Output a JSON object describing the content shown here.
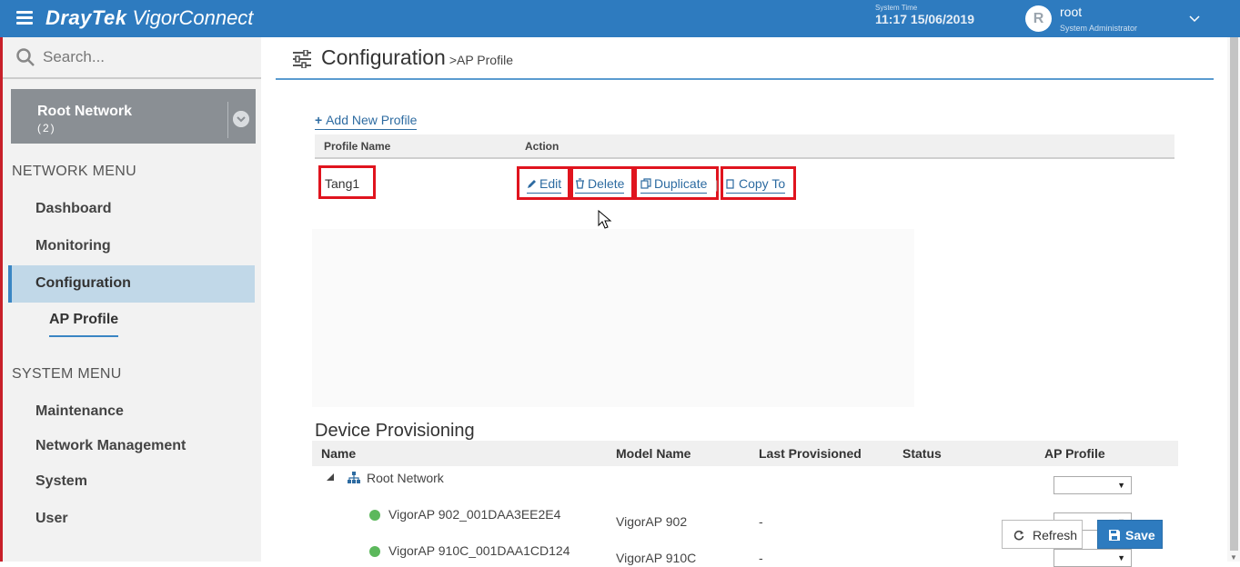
{
  "header": {
    "brand": "DrayTek",
    "product": "VigorConnect",
    "system_time_label": "System Time",
    "system_time": "11:17 15/06/2019",
    "avatar_letter": "R",
    "user_name": "root",
    "user_role": "System Administrator"
  },
  "sidebar": {
    "search_placeholder": "Search...",
    "network": {
      "name": "Root Network",
      "count": "(2)"
    },
    "network_menu_title": "NETWORK MENU",
    "network_menu": [
      "Dashboard",
      "Monitoring",
      "Configuration",
      "AP Profile"
    ],
    "system_menu_title": "SYSTEM MENU",
    "system_menu": [
      "Maintenance",
      "Network Management",
      "System",
      "User"
    ]
  },
  "page": {
    "title": "Configuration",
    "breadcrumb": ">AP Profile"
  },
  "profiles": {
    "add_label": "Add New Profile",
    "columns": [
      "Profile Name",
      "Action"
    ],
    "rows": [
      {
        "name": "Tang1"
      }
    ],
    "actions": {
      "edit": "Edit",
      "delete": "Delete",
      "duplicate": "Duplicate",
      "copy_to": "Copy To"
    }
  },
  "provisioning": {
    "title": "Device Provisioning",
    "columns": [
      "Name",
      "Model Name",
      "Last Provisioned",
      "Status",
      "AP Profile"
    ],
    "root_node": "Root Network",
    "devices": [
      {
        "name": "VigorAP 902_001DAA3EE2E4",
        "model": "VigorAP 902",
        "last": "-",
        "status": "ok"
      },
      {
        "name": "VigorAP 910C_001DAA1CD124",
        "model": "VigorAP 910C",
        "last": "-",
        "status": "ok"
      }
    ]
  },
  "buttons": {
    "refresh": "Refresh",
    "save": "Save"
  },
  "colors": {
    "header": "#2e7bbf",
    "highlight": "#e0141e",
    "active_menu": "#c1d8e8",
    "link": "#2d6ba1"
  }
}
